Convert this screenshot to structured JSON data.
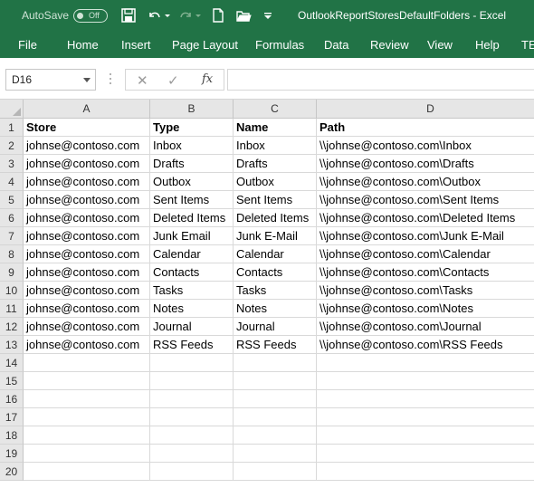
{
  "title_bar": {
    "autosave_label": "AutoSave",
    "autosave_state": "Off",
    "document_title": "OutlookReportStoresDefaultFolders  -  Excel",
    "background": "#217346"
  },
  "ribbon_tabs": [
    "File",
    "Home",
    "Insert",
    "Page Layout",
    "Formulas",
    "Data",
    "Review",
    "View",
    "Help",
    "TE"
  ],
  "formula_bar": {
    "name_box": "D16",
    "cancel_icon": "✕",
    "enter_icon": "✓",
    "fx_label": "fx",
    "value": ""
  },
  "sheet": {
    "columns": [
      "A",
      "B",
      "C",
      "D"
    ],
    "row_numbers": [
      "1",
      "2",
      "3",
      "4",
      "5",
      "6",
      "7",
      "8",
      "9",
      "10",
      "11",
      "12",
      "13",
      "14",
      "15",
      "16",
      "17",
      "18",
      "19",
      "20"
    ],
    "header_row": [
      "Store",
      "Type",
      "Name",
      "Path"
    ],
    "rows": [
      [
        "johnse@contoso.com",
        "Inbox",
        "Inbox",
        "\\\\johnse@contoso.com\\Inbox"
      ],
      [
        "johnse@contoso.com",
        "Drafts",
        "Drafts",
        "\\\\johnse@contoso.com\\Drafts"
      ],
      [
        "johnse@contoso.com",
        "Outbox",
        "Outbox",
        "\\\\johnse@contoso.com\\Outbox"
      ],
      [
        "johnse@contoso.com",
        "Sent Items",
        "Sent Items",
        "\\\\johnse@contoso.com\\Sent Items"
      ],
      [
        "johnse@contoso.com",
        "Deleted Items",
        "Deleted Items",
        "\\\\johnse@contoso.com\\Deleted Items"
      ],
      [
        "johnse@contoso.com",
        "Junk Email",
        "Junk E-Mail",
        "\\\\johnse@contoso.com\\Junk E-Mail"
      ],
      [
        "johnse@contoso.com",
        "Calendar",
        "Calendar",
        "\\\\johnse@contoso.com\\Calendar"
      ],
      [
        "johnse@contoso.com",
        "Contacts",
        "Contacts",
        "\\\\johnse@contoso.com\\Contacts"
      ],
      [
        "johnse@contoso.com",
        "Tasks",
        "Tasks",
        "\\\\johnse@contoso.com\\Tasks"
      ],
      [
        "johnse@contoso.com",
        "Notes",
        "Notes",
        "\\\\johnse@contoso.com\\Notes"
      ],
      [
        "johnse@contoso.com",
        "Journal",
        "Journal",
        "\\\\johnse@contoso.com\\Journal"
      ],
      [
        "johnse@contoso.com",
        "RSS Feeds",
        "RSS Feeds",
        "\\\\johnse@contoso.com\\RSS Feeds"
      ]
    ]
  },
  "icons": {
    "qat": [
      "save-icon",
      "undo-icon",
      "redo-icon",
      "new-file-icon",
      "open-folder-icon",
      "customize-qat-icon"
    ]
  }
}
